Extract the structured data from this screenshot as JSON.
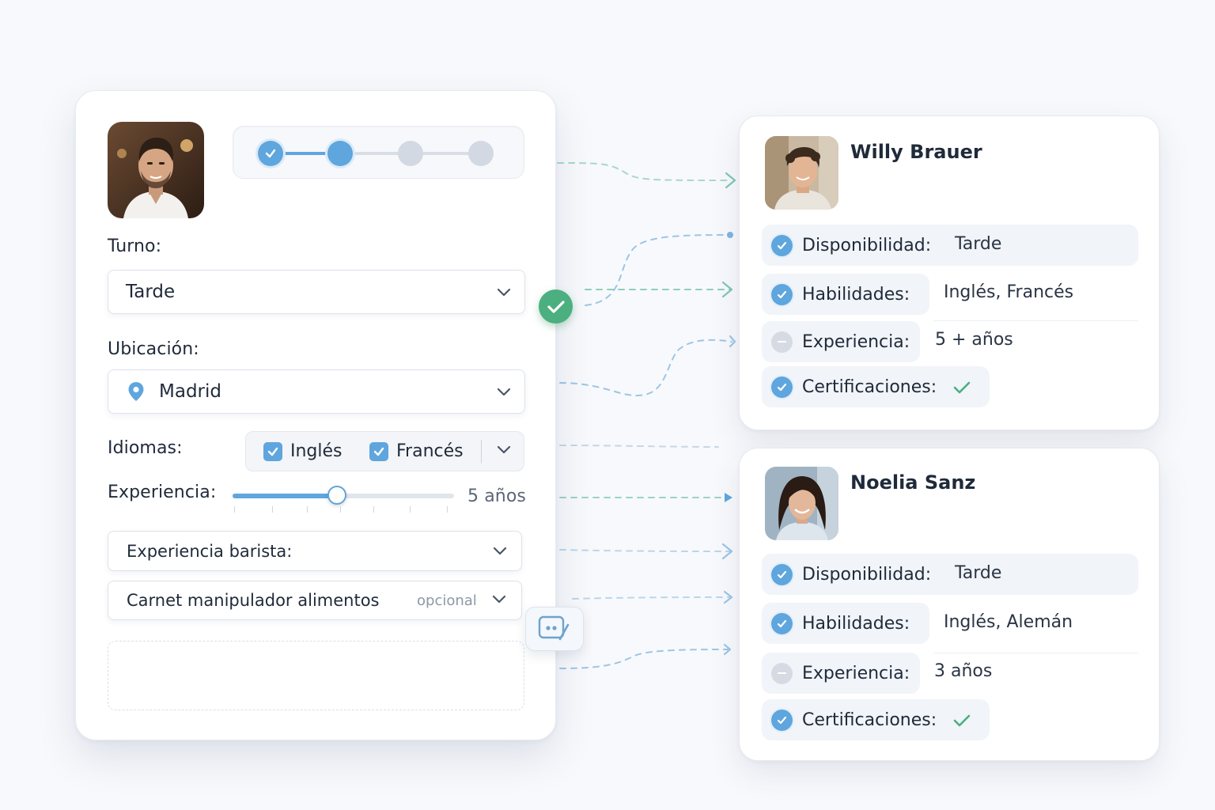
{
  "form": {
    "stepper": {
      "total_steps": 4,
      "current_step": 2,
      "completed_steps": 1
    },
    "shift": {
      "label": "Turno:",
      "value": "Tarde"
    },
    "location": {
      "label": "Ubicación:",
      "value": "Madrid"
    },
    "languages": {
      "label": "Idiomas:",
      "options": [
        "Inglés",
        "Francés"
      ]
    },
    "experience": {
      "label": "Experiencia:",
      "value_text": "5 años",
      "slider_fraction": 0.47
    },
    "barista": {
      "label": "Experiencia barista:"
    },
    "food_handler": {
      "label": "Carnet manipulador alimentos",
      "hint": "opcional"
    }
  },
  "candidates": [
    {
      "name": "Willy Brauer",
      "rows": [
        {
          "key": "Disponibilidad:",
          "value": "Tarde",
          "status": "ok"
        },
        {
          "key": "Habilidades:",
          "value": "Inglés, Francés",
          "status": "ok"
        },
        {
          "key": "Experiencia:",
          "value": "5 + años",
          "status": "neutral"
        },
        {
          "key": "Certificaciones:",
          "value": "",
          "status": "ok"
        }
      ]
    },
    {
      "name": "Noelia Sanz",
      "rows": [
        {
          "key": "Disponibilidad:",
          "value": "Tarde",
          "status": "ok"
        },
        {
          "key": "Habilidades:",
          "value": "Inglés, Alemán",
          "status": "ok"
        },
        {
          "key": "Experiencia:",
          "value": "3 años",
          "status": "neutral"
        },
        {
          "key": "Certificaciones:",
          "value": "",
          "status": "ok"
        }
      ]
    }
  ],
  "colors": {
    "accent_blue": "#5ea6dd",
    "success_green": "#4caf7f",
    "connector_teal": "#7fc8b4",
    "connector_blue": "#9cc6e6"
  },
  "icons": [
    "check-icon",
    "location-pin-icon",
    "chevron-down-icon",
    "chat-edit-icon",
    "minus-icon"
  ]
}
